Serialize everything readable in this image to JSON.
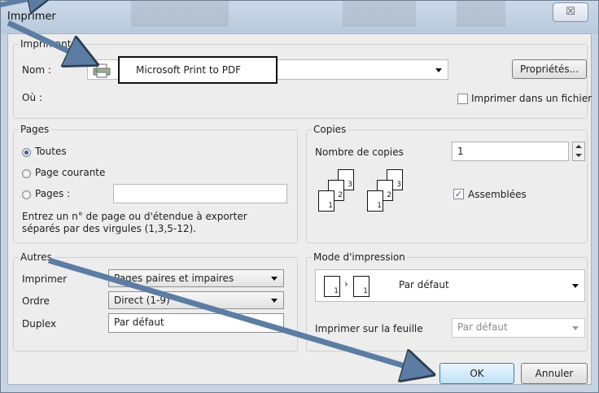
{
  "window": {
    "title": "Imprimer",
    "close_glyph": "☒"
  },
  "printer": {
    "group_label": "Imprimante",
    "name_label": "Nom :",
    "name_value": "Microsoft Print to PDF",
    "where_label": "Où :",
    "properties_button": "Propriétés...",
    "print_to_file_label": "Imprimer dans un fichier",
    "print_to_file_checked": false
  },
  "pages": {
    "group_label": "Pages",
    "all_label": "Toutes",
    "current_label": "Page courante",
    "pages_label": "Pages :",
    "pages_value": "",
    "hint_line1": "Entrez un n° de page ou d'étendue à exporter",
    "hint_line2": "séparés par des virgules (1,3,5-12).",
    "selected": "all"
  },
  "copies": {
    "group_label": "Copies",
    "count_label": "Nombre de copies",
    "count_value": "1",
    "collate_label": "Assemblées",
    "collate_checked": true,
    "page_numbers": [
      "1",
      "2",
      "3"
    ]
  },
  "others": {
    "group_label": "Autres",
    "print_label": "Imprimer",
    "print_value": "Pages paires et impaires",
    "order_label": "Ordre",
    "order_value": "Direct (1-9)",
    "duplex_label": "Duplex",
    "duplex_value": "Par défaut"
  },
  "print_mode": {
    "group_label": "Mode d'impression",
    "mode_value": "Par défaut",
    "sheet_label": "Imprimer sur la feuille",
    "sheet_value": "Par défaut",
    "page_numbers": [
      "1",
      "1"
    ]
  },
  "buttons": {
    "ok": "OK",
    "cancel": "Annuler"
  },
  "colors": {
    "annotation_arrow": "#5c7da3",
    "accent": "#2a5fb0",
    "window_chrome": "#c7d3e2"
  }
}
